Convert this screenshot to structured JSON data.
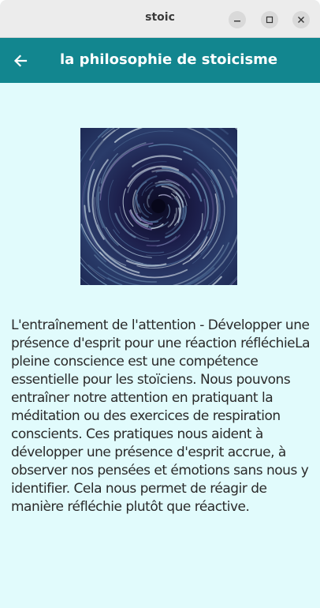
{
  "window": {
    "title": "stoic",
    "controls": {
      "minimize_icon": "minimize-icon",
      "maximize_icon": "maximize-icon",
      "close_icon": "close-icon"
    }
  },
  "appbar": {
    "back_icon": "arrow-left-icon",
    "title": "la philosophie de stoicisme",
    "color": "#12868f"
  },
  "content": {
    "background": "#e1fbfc",
    "image_icon": "spiral-vortex-image",
    "body": "L'entraînement de l'attention - Développer une présence d'esprit pour une réaction réfléchieLa pleine conscience est une compétence essentielle pour les stoïciens. Nous pouvons entraîner notre attention en pratiquant la méditation ou des exercices de respiration conscients. Ces pratiques nous aident à développer une présence d'esprit accrue, à observer nos pensées et émotions sans nous y identifier. Cela nous permet de réagir de manière réfléchie plutôt que réactive."
  }
}
